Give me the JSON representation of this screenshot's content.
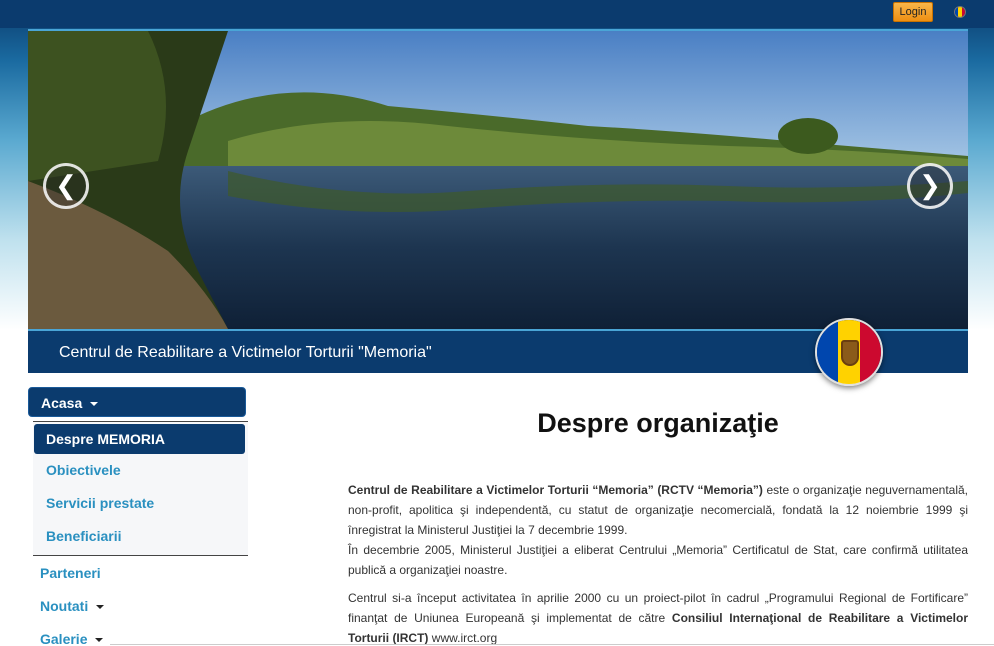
{
  "header": {
    "login_label": "Login",
    "flag_icon": "moldova-flag-icon",
    "flag_colors": [
      "#0046ae",
      "#ffd200",
      "#cc092f"
    ]
  },
  "hero": {
    "prev_label": "❮",
    "next_label": "❯",
    "banner_title": "Centrul de Reabilitare a Victimelor Torturii \"Memoria\""
  },
  "sidebar": {
    "acasa": "Acasa",
    "submenu": [
      "Despre MEMORIA",
      "Obiectivele",
      "Servicii prestate",
      "Beneficiarii"
    ],
    "items": [
      "Parteneri",
      "Noutati",
      "Galerie"
    ]
  },
  "main": {
    "title": "Despre organizaţie",
    "p1_bold": "Centrul de Reabilitare a Victimelor Torturii “Memoria” (RCTV “Memoria”)",
    "p1_rest": " este o organizaţie neguvernamentală, non-profit, apolitica şi independentă, cu statut de organizaţie necomercială, fondată la 12 noiembrie 1999 şi înregistrat la Ministerul Justiţiei la 7 decembrie 1999.",
    "p1_line2": "În decembrie 2005, Ministerul Justiţiei a eliberat Centrului „Memoria” Certificatul de Stat, care confirmă utilitatea publică a organizaţiei noastre.",
    "p2_start": "Centrul si-a început activitatea în aprilie 2000 cu un proiect-pilot în cadrul „Programului Regional de Fortificare” finanţat de Uniunea Europeană şi implementat de către ",
    "p2_bold": "Consiliul Internaţional de Reabilitare a Victimelor Torturii (IRCT)",
    "p2_link": " www.irct.org"
  }
}
